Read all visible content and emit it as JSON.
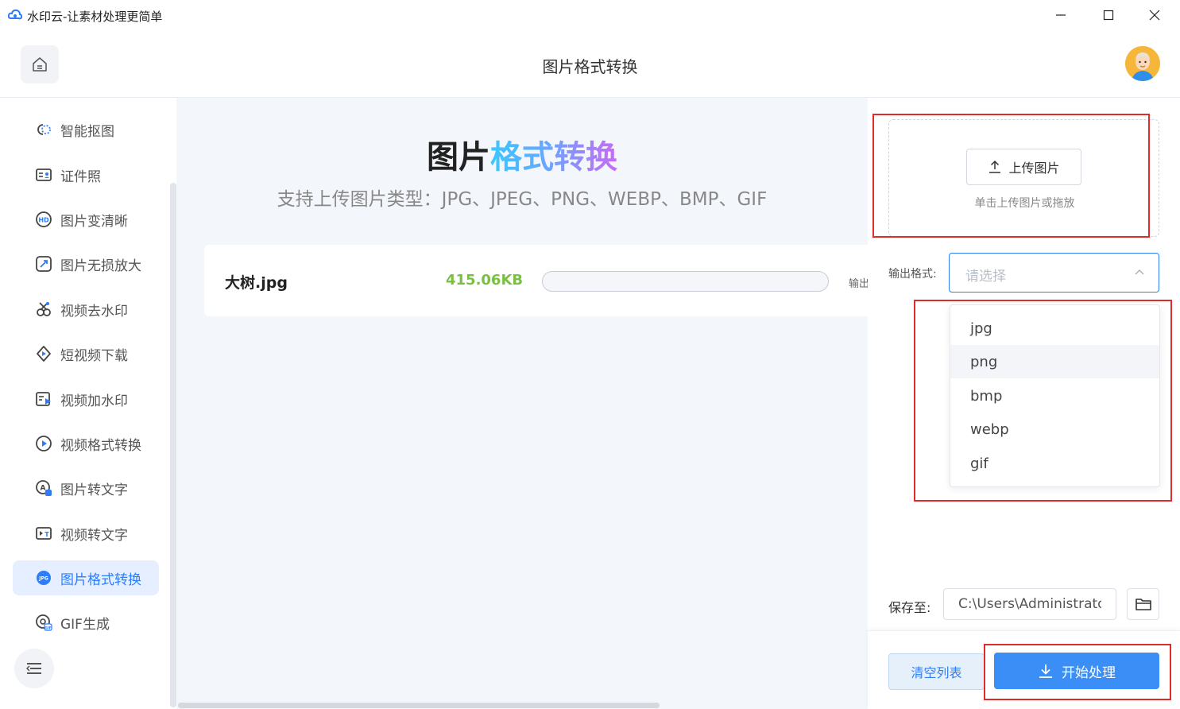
{
  "window": {
    "title": "水印云-让素材处理更简单"
  },
  "header": {
    "title": "图片格式转换"
  },
  "sidebar": {
    "items": [
      {
        "label": "智能抠图",
        "icon": "smart-cutout-icon"
      },
      {
        "label": "证件照",
        "icon": "id-photo-icon"
      },
      {
        "label": "图片变清晰",
        "icon": "hd-icon"
      },
      {
        "label": "图片无损放大",
        "icon": "enlarge-icon"
      },
      {
        "label": "视频去水印",
        "icon": "video-remove-watermark-icon"
      },
      {
        "label": "短视频下载",
        "icon": "short-video-download-icon"
      },
      {
        "label": "视频加水印",
        "icon": "video-add-watermark-icon"
      },
      {
        "label": "视频格式转换",
        "icon": "video-format-icon"
      },
      {
        "label": "图片转文字",
        "icon": "image-to-text-icon"
      },
      {
        "label": "视频转文字",
        "icon": "video-to-text-icon"
      },
      {
        "label": "图片格式转换",
        "icon": "jpg-icon",
        "active": true
      },
      {
        "label": "GIF生成",
        "icon": "gif-icon"
      }
    ]
  },
  "main": {
    "hero_title_part1": "图片",
    "hero_title_part2": "格式转换",
    "hero_subtitle": "支持上传图片类型：JPG、JPEG、PNG、WEBP、BMP、GIF",
    "file": {
      "name": "大树.jpg",
      "size": "415.06KB",
      "progress": 0,
      "output_label": "输出"
    }
  },
  "right_panel": {
    "upload_button": "上传图片",
    "upload_hint": "单击上传图片或拖放",
    "format_label": "输出格式:",
    "format_placeholder": "请选择",
    "format_options": [
      "jpg",
      "png",
      "bmp",
      "webp",
      "gif"
    ],
    "hovered_option": "png",
    "save_label": "保存至:",
    "save_path": "C:\\Users\\Administrator",
    "clear_button": "清空列表",
    "start_button": "开始处理"
  },
  "colors": {
    "accent": "#2f7df6",
    "file_size": "#7ac143",
    "highlight_box": "#e02b2b"
  }
}
